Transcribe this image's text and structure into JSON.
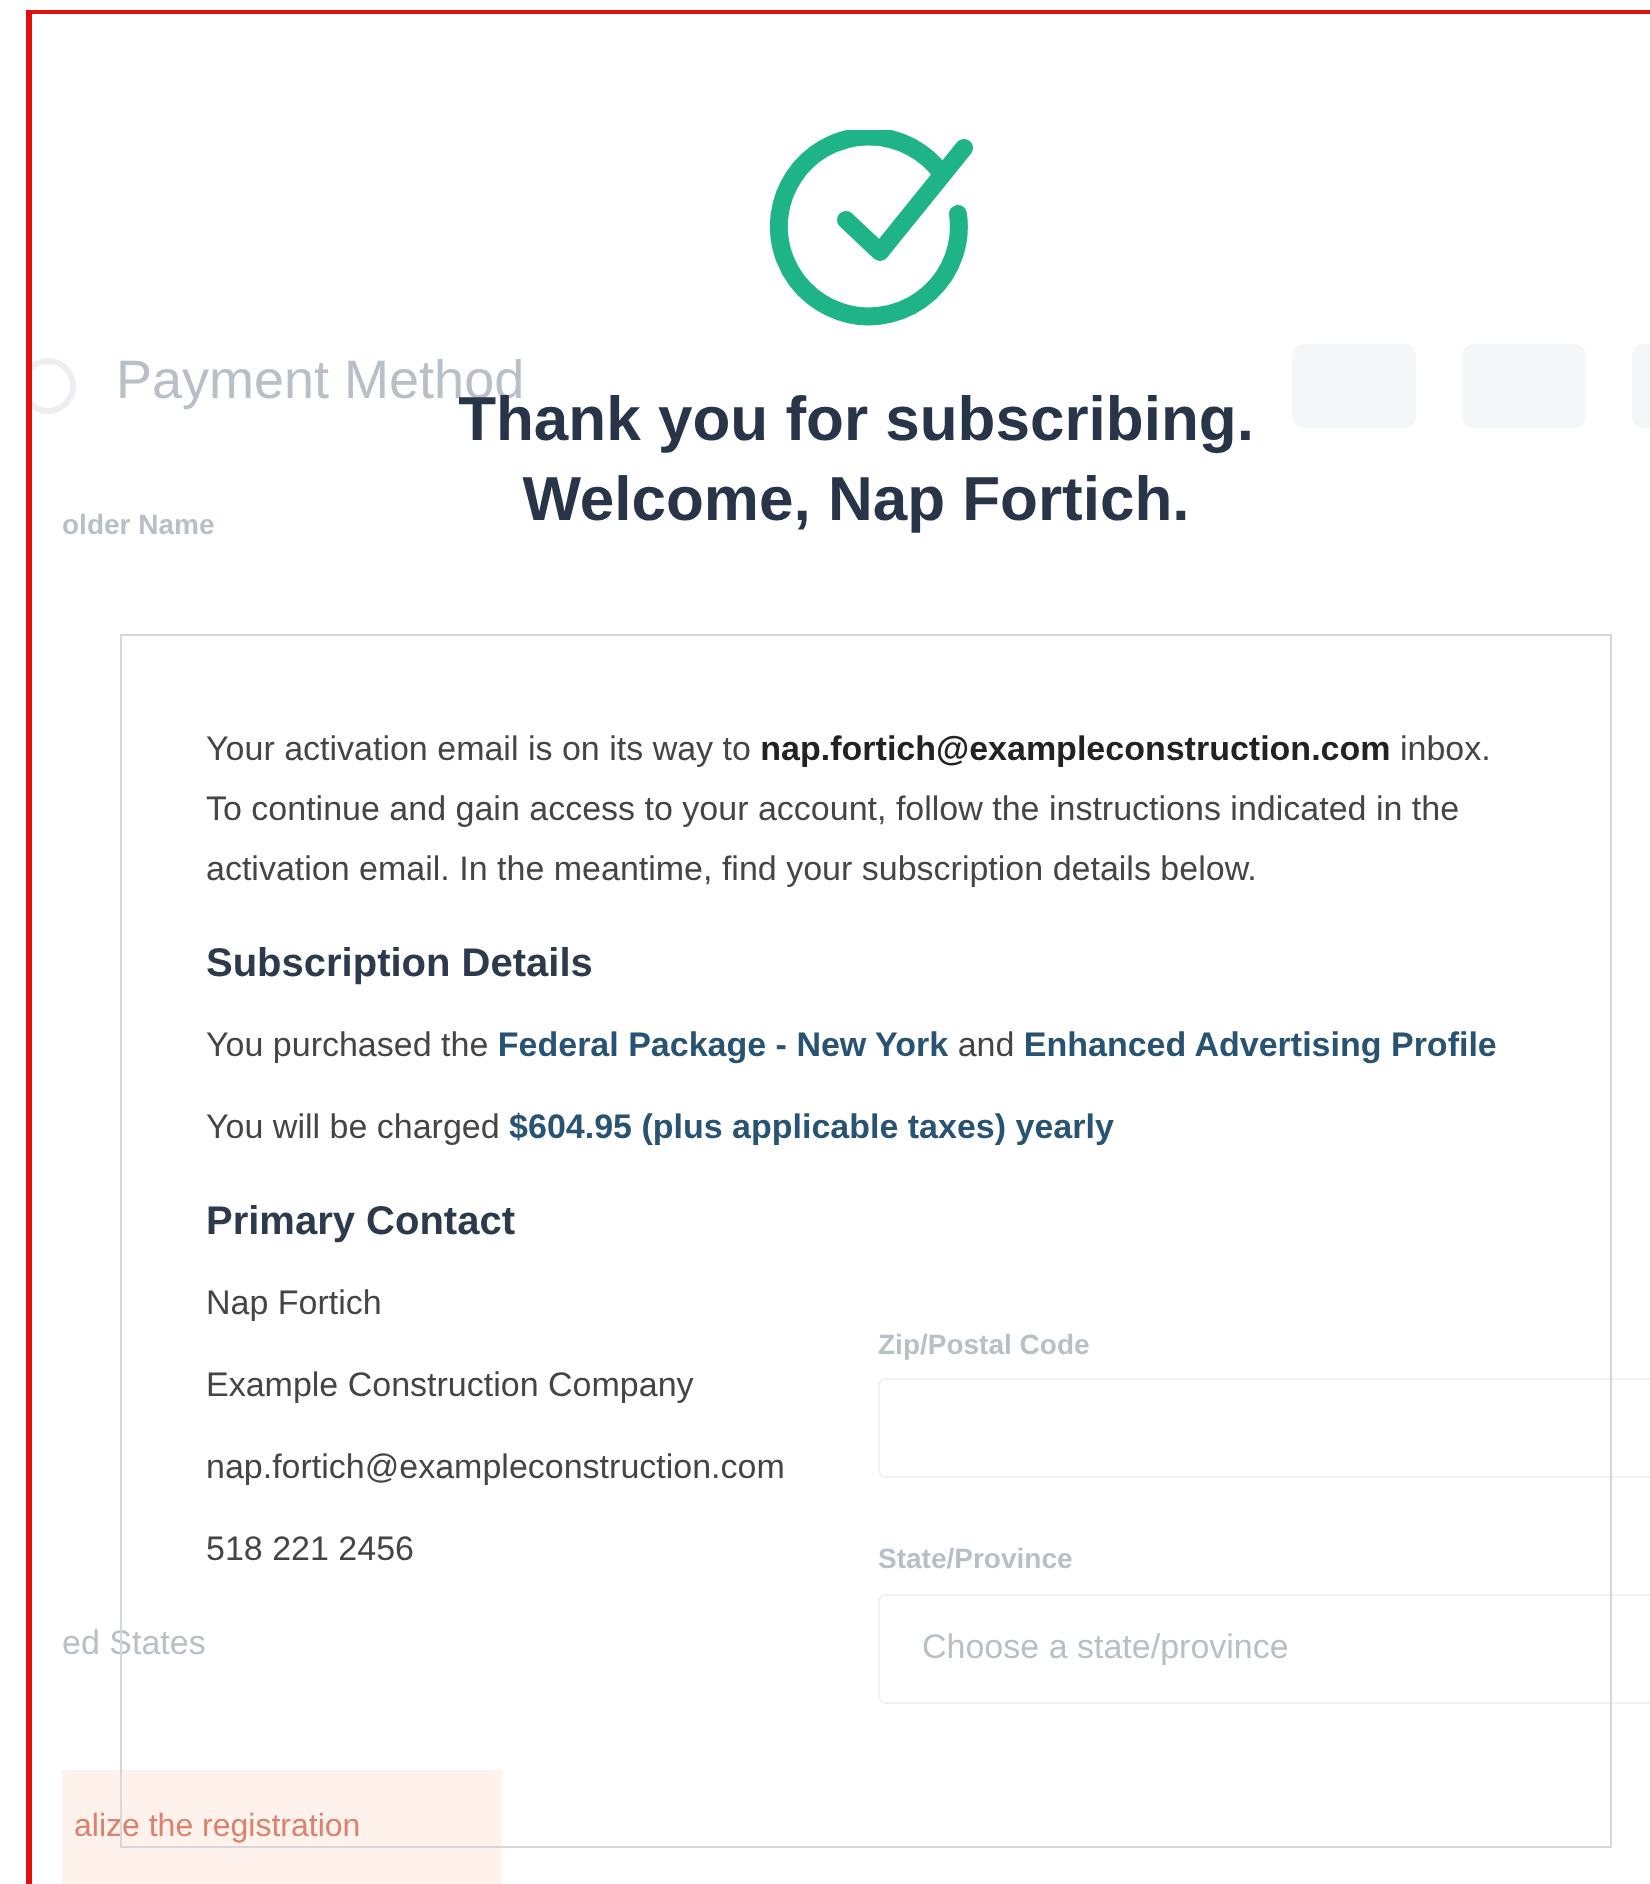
{
  "background": {
    "section_title": "Payment Method",
    "holder_label": "older Name",
    "zip_label": "Zip/Postal Code",
    "state_label": "State/Province",
    "state_placeholder": "Choose a state/province",
    "country_value": "ed States",
    "submit_button": "alize the registration"
  },
  "header": {
    "title_lines": [
      "Thank you for subscribing.",
      "Welcome, Nap Fortich."
    ]
  },
  "card": {
    "intro": "Your activation email is on its way to **nap.fortich@exampleconstruction.com** inbox. To continue and gain access to your account, follow the instructions indicated in the activation email. In the meantime, find your subscription details below.",
    "sections": [
      {
        "heading": "Subscription Details",
        "kind": "summary",
        "lines": [
          "You purchased the **Federal Package - New York** and **Enhanced Advertising Profile**",
          "You will be charged **$604.95 (plus applicable taxes) yearly**"
        ]
      },
      {
        "heading": "Primary Contact",
        "kind": "contact",
        "lines": [
          "Nap Fortich",
          "Example Construction Company",
          "nap.fortich@exampleconstruction.com",
          "518 221 2456"
        ]
      }
    ]
  }
}
